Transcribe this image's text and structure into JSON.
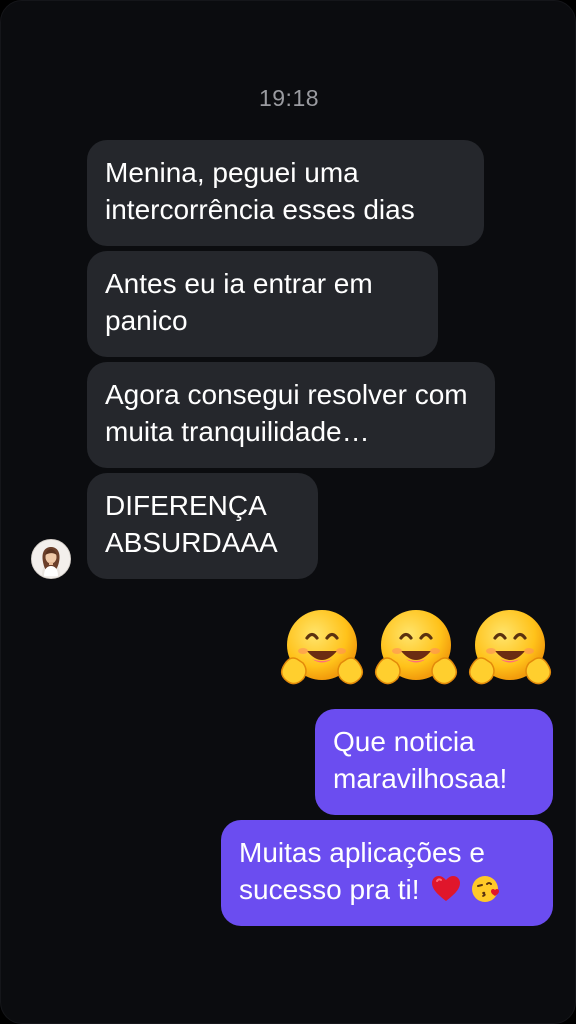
{
  "chat": {
    "timestamp": "19:18",
    "incoming": [
      {
        "text": "Menina, peguei uma intercorrência esses dias"
      },
      {
        "text": "Antes eu ia entrar em panico"
      },
      {
        "text": "Agora consegui resolver com muita tranquilidade…"
      },
      {
        "text": "DIFERENÇA ABSURDAAA"
      }
    ],
    "reaction_emojis": [
      "hugging-face",
      "hugging-face",
      "hugging-face"
    ],
    "outgoing": [
      {
        "text": "Que noticia maravilhosaa!"
      },
      {
        "text": "Muitas aplicações e sucesso pra ti!",
        "emojis": [
          "red-heart",
          "face-blowing-kiss"
        ]
      }
    ]
  },
  "colors": {
    "background": "#0b0c0f",
    "incoming_bubble": "#25272c",
    "outgoing_bubble": "#6b4df0",
    "timestamp": "#9a9ba0"
  }
}
